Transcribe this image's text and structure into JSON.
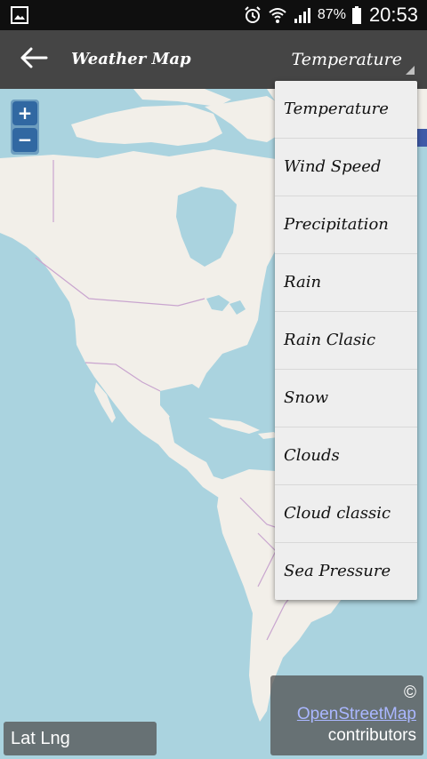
{
  "status_bar": {
    "battery": "87%",
    "time": "20:53",
    "icons": [
      "gallery-icon",
      "alarm-icon",
      "wifi-icon",
      "signal-icon",
      "battery-icon"
    ]
  },
  "app_bar": {
    "title": "Weather Map",
    "back_icon": "arrow-left-icon",
    "selected_layer": "Temperature"
  },
  "layer_menu": {
    "items": [
      "Temperature",
      "Wind Speed",
      "Precipitation",
      "Rain",
      "Rain Clasic",
      "Snow",
      "Clouds",
      "Cloud classic",
      "Sea Pressure"
    ]
  },
  "map": {
    "zoom_in": "+",
    "zoom_out": "−",
    "coords_label": "Lat Lng",
    "attribution": {
      "prefix": "©",
      "link": "OpenStreetMap",
      "suffix": "contributors"
    }
  },
  "colors": {
    "water": "#aad3df",
    "land": "#f2efe9",
    "border": "#c9a5cf",
    "app_bar": "#454545",
    "menu_bg": "#eeeeee",
    "link": "#aab7ff"
  }
}
